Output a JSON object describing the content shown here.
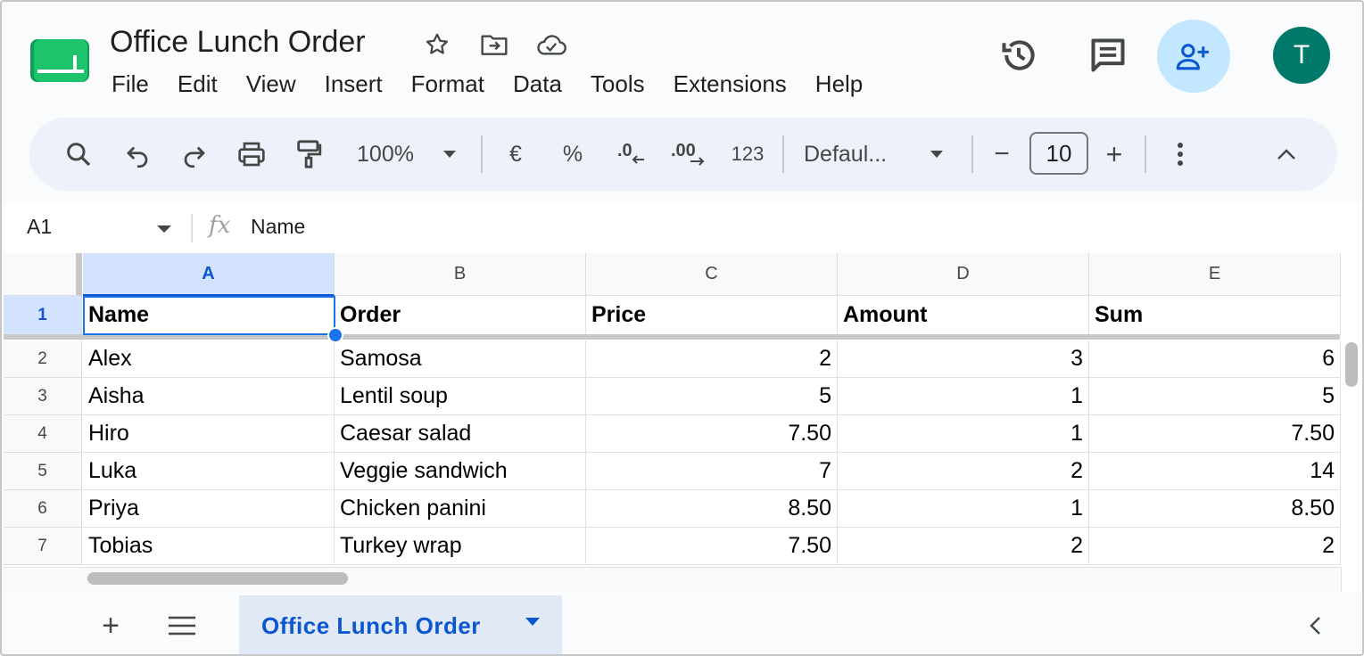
{
  "title_bar": {
    "doc_title": "Office Lunch Order",
    "icons": [
      "star-icon",
      "move-to-folder-icon",
      "cloud-saved-icon"
    ]
  },
  "menu": [
    "File",
    "Edit",
    "View",
    "Insert",
    "Format",
    "Data",
    "Tools",
    "Extensions",
    "Help"
  ],
  "top_right": {
    "icons": [
      "version-history-icon",
      "comments-icon",
      "share-add-person-icon"
    ],
    "avatar_letter": "T",
    "avatar_color": "#00796b",
    "share_bg": "#c2e7ff"
  },
  "toolbar": {
    "zoom": "100%",
    "currency": "€",
    "percent": "%",
    "decrease_decimal": ".0",
    "increase_decimal": ".00",
    "more_formats": "123",
    "font": "Defaul...",
    "font_size": "10",
    "minus": "−",
    "plus": "+"
  },
  "formula_bar": {
    "cell_ref": "A1",
    "fx": "fx",
    "content": "Name"
  },
  "grid": {
    "columns": [
      "A",
      "B",
      "C",
      "D",
      "E"
    ],
    "selected_column": "A",
    "selected_row": "1",
    "header_row": {
      "num": "1",
      "cells": [
        "Name",
        "Order",
        "Price",
        "Amount",
        "Sum"
      ]
    },
    "rows": [
      {
        "num": "2",
        "cells": [
          "Alex",
          "Samosa",
          "2",
          "3",
          "6"
        ]
      },
      {
        "num": "3",
        "cells": [
          "Aisha",
          "Lentil soup",
          "5",
          "1",
          "5"
        ]
      },
      {
        "num": "4",
        "cells": [
          "Hiro",
          "Caesar salad",
          "7.50",
          "1",
          "7.50"
        ]
      },
      {
        "num": "5",
        "cells": [
          "Luka",
          "Veggie sandwich",
          "7",
          "2",
          "14"
        ]
      },
      {
        "num": "6",
        "cells": [
          "Priya",
          "Chicken panini",
          "8.50",
          "1",
          "8.50"
        ]
      },
      {
        "num": "7",
        "cells": [
          "Tobias",
          "Turkey wrap",
          "7.50",
          "2",
          "2"
        ]
      }
    ],
    "accent": "#1a73e8"
  },
  "sheets": {
    "add": "+",
    "active_tab": "Office Lunch Order"
  }
}
